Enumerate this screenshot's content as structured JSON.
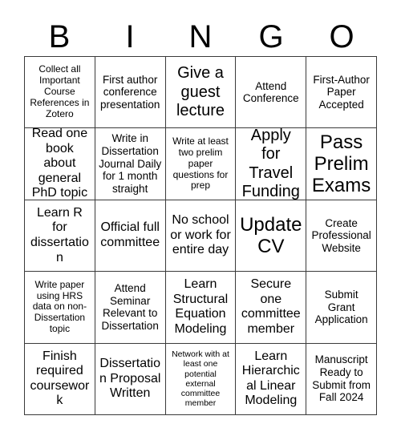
{
  "header": {
    "letters": [
      "B",
      "I",
      "N",
      "G",
      "O"
    ]
  },
  "grid": {
    "rows": 5,
    "columns": 5,
    "border_color": "#3a3a3a",
    "background_color": "#ffffff",
    "text_color": "#000000",
    "cells": [
      {
        "text": "Collect all Important Course References in Zotero",
        "size": "sm"
      },
      {
        "text": "First author conference presentation",
        "size": "md"
      },
      {
        "text": "Give a guest lecture",
        "size": "xl"
      },
      {
        "text": "Attend Conference",
        "size": "md"
      },
      {
        "text": "First-Author Paper Accepted",
        "size": "md"
      },
      {
        "text": "Read one book about general PhD topic",
        "size": "lg"
      },
      {
        "text": "Write in Dissertation Journal Daily for 1 month straight",
        "size": "md"
      },
      {
        "text": "Write at least two prelim paper questions for prep",
        "size": "sm"
      },
      {
        "text": "Apply for Travel Funding",
        "size": "xl"
      },
      {
        "text": "Pass Prelim Exams",
        "size": "xxl"
      },
      {
        "text": "Learn R for dissertation",
        "size": "lg"
      },
      {
        "text": "Official full committee",
        "size": "lg"
      },
      {
        "text": "No school or work for entire day",
        "size": "lg"
      },
      {
        "text": "Update CV",
        "size": "xxl"
      },
      {
        "text": "Create Professional Website",
        "size": "md"
      },
      {
        "text": "Write paper using HRS data on non-Dissertation topic",
        "size": "sm"
      },
      {
        "text": "Attend Seminar Relevant to Dissertation",
        "size": "md"
      },
      {
        "text": "Learn Structural Equation Modeling",
        "size": "lg"
      },
      {
        "text": "Secure one committee member",
        "size": "lg"
      },
      {
        "text": "Submit Grant Application",
        "size": "md"
      },
      {
        "text": "Finish required coursework",
        "size": "lg"
      },
      {
        "text": "Dissertation Proposal Written",
        "size": "lg"
      },
      {
        "text": "Network with at least one potential external committee member",
        "size": "xs"
      },
      {
        "text": "Learn Hierarchical Linear Modeling",
        "size": "lg"
      },
      {
        "text": "Manuscript Ready to Submit from Fall 2024",
        "size": "md"
      }
    ]
  }
}
